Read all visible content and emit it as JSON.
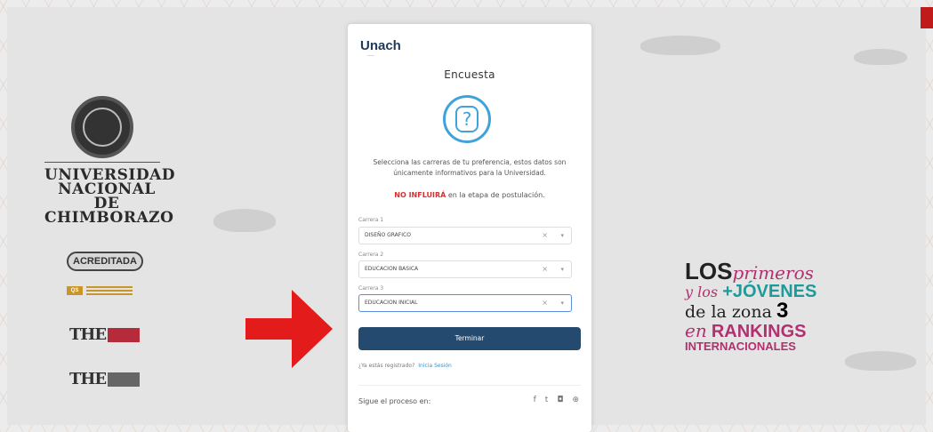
{
  "university": {
    "name_lines": [
      "UNIVERSIDAD",
      "NACIONAL DE",
      "CHIMBORAZO"
    ],
    "accreditation_badge": "ACREDITADA",
    "qs_badge": "QS",
    "the_badge_1": "THE",
    "the_badge_2": "THE"
  },
  "slogan": {
    "los": "LOS",
    "primeros": "primeros",
    "y_los": "y los",
    "jovenes": "+JÓVENES",
    "de_la_zona": "de la zona",
    "zona_num": "3",
    "en": "en",
    "rankings": "RANKINGS",
    "internacionales": "INTERNACIONALES"
  },
  "card": {
    "logo": "Unach",
    "title": "Encuesta",
    "message": "Selecciona las carreras de tu preferencia, estos datos son únicamente informativos para la Universidad.",
    "warning_bold": "NO INFLUIRÁ",
    "warning_rest": " en la etapa de postulación.",
    "fields": [
      {
        "label": "Carrera 1",
        "value": "DISEÑO GRAFICO"
      },
      {
        "label": "Carrera 2",
        "value": "EDUCACION BASICA"
      },
      {
        "label": "Carrera 3",
        "value": "EDUCACION INICIAL"
      }
    ],
    "clear_glyph": "×",
    "arrow_glyph": "▾",
    "submit_label": "Terminar",
    "register_question": "¿Ya estás registrado?",
    "login_link": "Inicia Sesión",
    "follow_label": "Sigue el proceso en:",
    "social_icons": [
      "facebook-icon",
      "twitter-icon",
      "instagram-icon",
      "web-icon"
    ],
    "social_glyphs": [
      "f",
      "t",
      "◘",
      "⊕"
    ]
  },
  "colors": {
    "button": "#244a70",
    "accent": "#3fa2db",
    "warning": "#d83030",
    "arrow": "#e31b1b"
  }
}
